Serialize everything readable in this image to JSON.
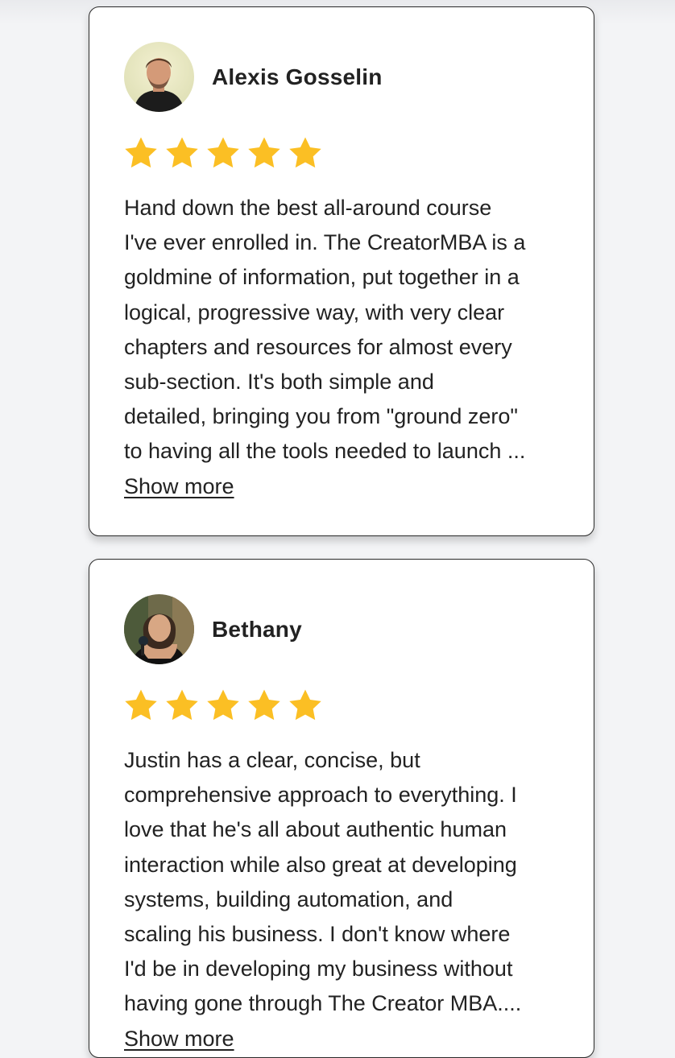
{
  "reviews": [
    {
      "name": "Alexis Gosselin",
      "rating": 5,
      "lines": [
        "Hand down the best all-around course",
        "I've ever enrolled in. The CreatorMBA is a",
        "goldmine of information, put together in a",
        "logical, progressive way, with very clear",
        "chapters and resources for almost every",
        "sub-section. It's both simple and",
        "detailed, bringing you from \"ground zero\"",
        "to having all the tools needed to launch ..."
      ],
      "show_more_label": "Show more"
    },
    {
      "name": "Bethany",
      "rating": 5,
      "lines": [
        "Justin has a clear, concise, but",
        "comprehensive approach to everything. I",
        "love that he's all about authentic human",
        "interaction while also great at developing",
        "systems, building automation, and",
        "scaling his business. I don't know where",
        "I'd be in developing my business without",
        "having gone through The Creator MBA....",
        "Show more"
      ]
    }
  ],
  "colors": {
    "star": "#fbbf24",
    "card_border": "#2a2a2a",
    "background": "#f3f4f6"
  }
}
